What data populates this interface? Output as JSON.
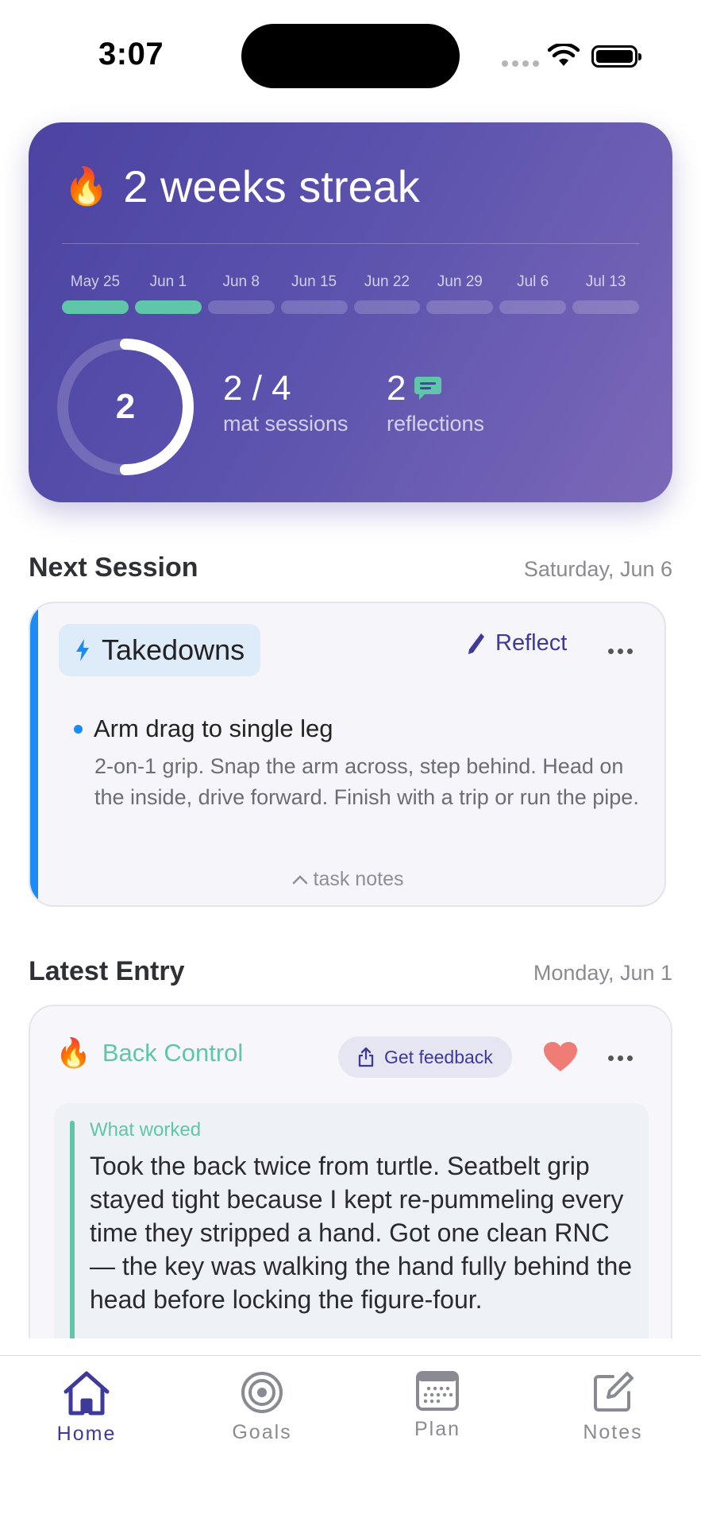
{
  "status_bar": {
    "time": "3:07"
  },
  "streak": {
    "flame_icon": "🔥",
    "title": "2 weeks streak",
    "weeks": [
      {
        "label": "May 25",
        "done": true
      },
      {
        "label": "Jun 1",
        "done": true
      },
      {
        "label": "Jun 8",
        "done": false
      },
      {
        "label": "Jun 15",
        "done": false
      },
      {
        "label": "Jun 22",
        "done": false
      },
      {
        "label": "Jun 29",
        "done": false
      },
      {
        "label": "Jul 6",
        "done": false
      },
      {
        "label": "Jul 13",
        "done": false
      }
    ],
    "ring_value": "2",
    "ring_progress": 0.5,
    "sessions_value": "2 / 4",
    "sessions_label": "mat sessions",
    "reflections_value": "2",
    "reflections_label": "reflections",
    "colors": {
      "done": "#5fc6aa",
      "card_start": "#4c43a2",
      "card_end": "#7c68b8"
    }
  },
  "next_session": {
    "heading": "Next Session",
    "date": "Saturday, Jun 6",
    "tag_icon": "bolt-icon",
    "tag": "Takedowns",
    "reflect_label": "Reflect",
    "task_title": "Arm drag to single leg",
    "task_desc": "2-on-1 grip. Snap the arm across, step behind. Head on the inside, drive forward. Finish with a trip or run the pipe.",
    "notes_toggle": "task notes",
    "accent": "#1b8cf5"
  },
  "latest_entry": {
    "heading": "Latest Entry",
    "date": "Monday, Jun 1",
    "flame_icon": "🔥",
    "name": "Back Control",
    "feedback_label": "Get feedback",
    "worked_label": "What worked",
    "worked_text": "Took the back twice from turtle. Seatbelt grip stayed tight because I kept re-pummeling every time they stripped a hand. Got one clean RNC — the key was walking the hand fully behind the head before locking the figure-four."
  },
  "tabs": [
    {
      "label": "Home",
      "icon": "home-icon",
      "active": true
    },
    {
      "label": "Goals",
      "icon": "target-icon",
      "active": false
    },
    {
      "label": "Plan",
      "icon": "calendar-icon",
      "active": false
    },
    {
      "label": "Notes",
      "icon": "compose-icon",
      "active": false
    }
  ]
}
